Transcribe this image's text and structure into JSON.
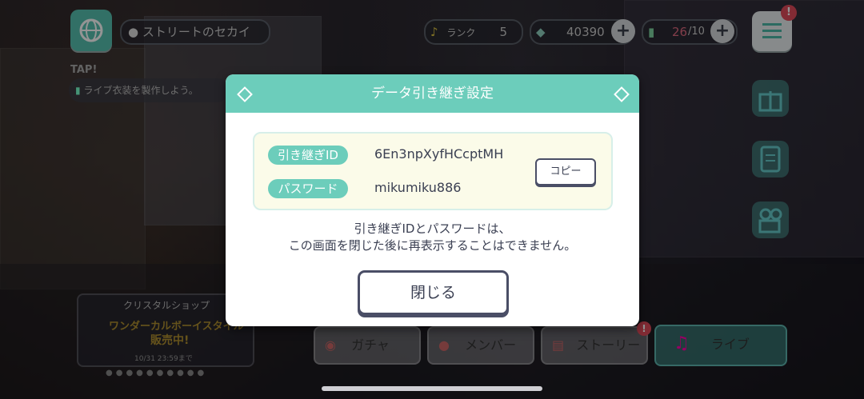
{
  "top": {
    "location": "ストリートのセカイ",
    "rank_label": "ランク",
    "rank_value": "5",
    "coins": "40390",
    "stamina": "26/10",
    "stamina_current": "26",
    "stamina_max": "/10",
    "menu_badge": "!"
  },
  "background": {
    "tap_label": "TAP!",
    "mission": "ライブ衣装を製作しよう。",
    "shop_title": "クリスタルショップ",
    "shop_banner": "ワンダーカルボーイスタイル",
    "shop_sale": "販売中!",
    "shop_date": "10/31 23:59まで",
    "nav": {
      "gacha": "ガチャ",
      "member": "メンバー",
      "story": "ストーリー",
      "live": "ライブ"
    }
  },
  "dialog": {
    "title": "データ引き継ぎ設定",
    "id_label": "引き継ぎID",
    "id_value": "6En3npXyfHCcptMH",
    "password_label": "パスワード",
    "password_value": "mikumiku886",
    "copy_button": "コピー",
    "message_line1": "引き継ぎIDとパスワードは、",
    "message_line2": "この画面を閉じた後に再表示することはできません。",
    "close_button": "閉じる"
  },
  "colors": {
    "accent": "#6ccdbb",
    "text": "#3a3f52",
    "info_bg": "#fbfbe9"
  }
}
